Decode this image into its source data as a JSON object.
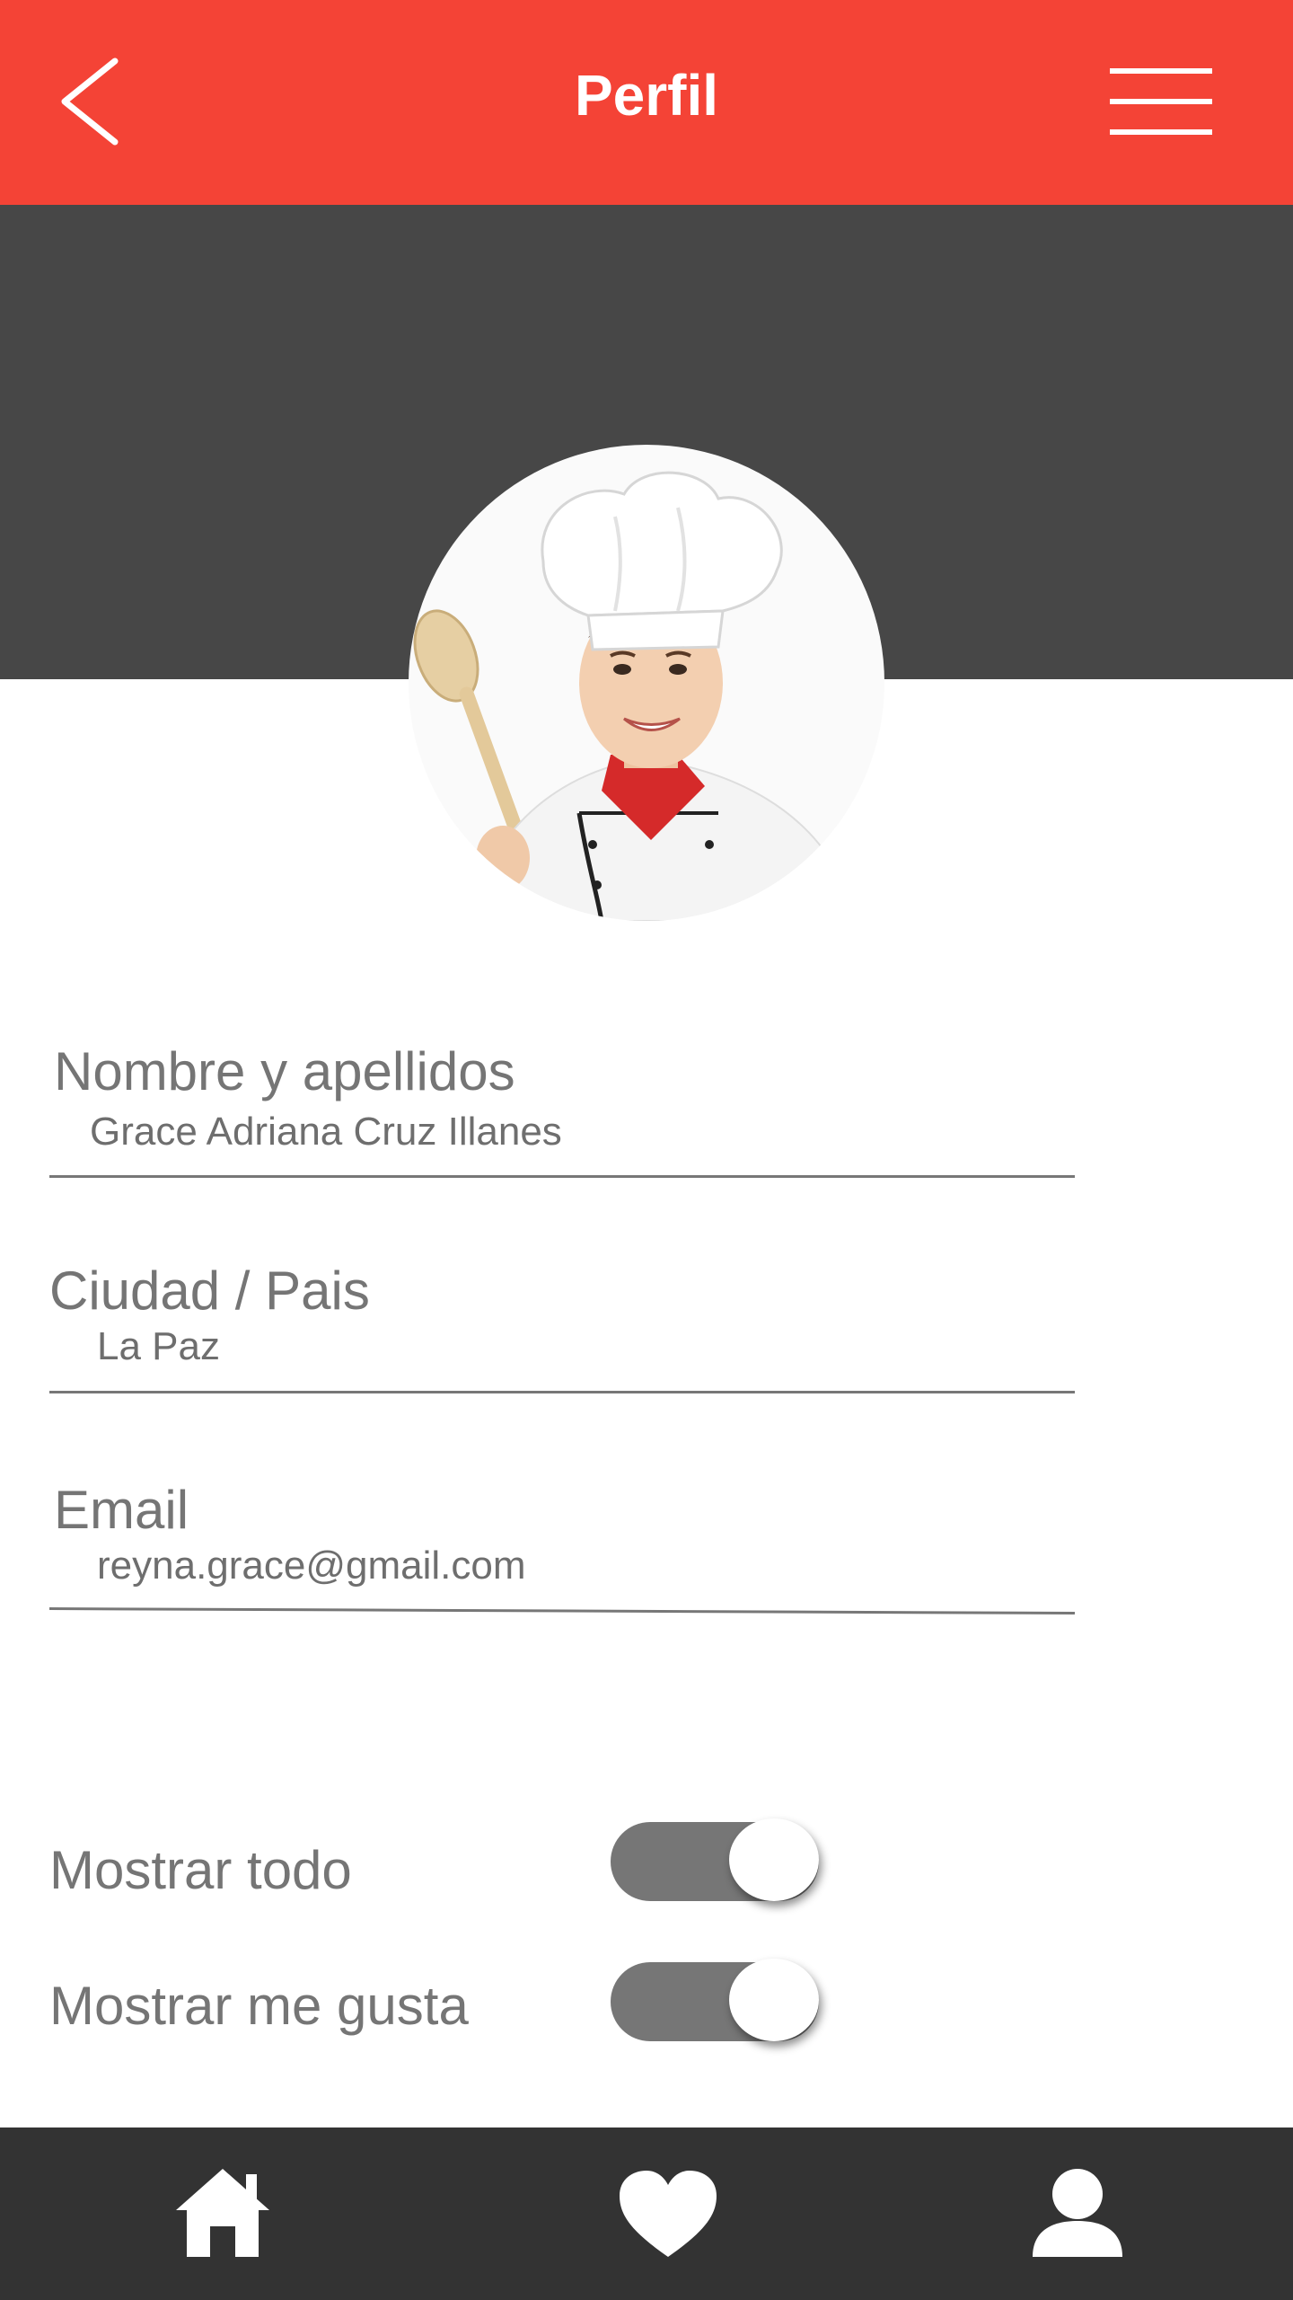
{
  "header": {
    "title": "Perfil",
    "back_icon": "chevron-left-icon",
    "menu_icon": "hamburger-menu-icon"
  },
  "profile": {
    "avatar": "chef-woman-avatar"
  },
  "fields": {
    "name": {
      "label": "Nombre y apellidos",
      "value": "Grace Adriana Cruz Illanes"
    },
    "city": {
      "label": "Ciudad / Pais",
      "value": "La Paz"
    },
    "email": {
      "label": "Email",
      "value": "reyna.grace@gmail.com"
    }
  },
  "toggles": {
    "show_all": {
      "label": "Mostrar todo",
      "state": "on"
    },
    "show_likes": {
      "label": "Mostrar me gusta",
      "state": "on"
    }
  },
  "bottom_nav": {
    "items": [
      {
        "icon": "home-icon"
      },
      {
        "icon": "heart-icon"
      },
      {
        "icon": "user-icon"
      }
    ]
  },
  "colors": {
    "primary": "#f44336",
    "cover": "#474747",
    "nav": "#333333",
    "toggle_track": "#767676",
    "text": "#757575"
  }
}
